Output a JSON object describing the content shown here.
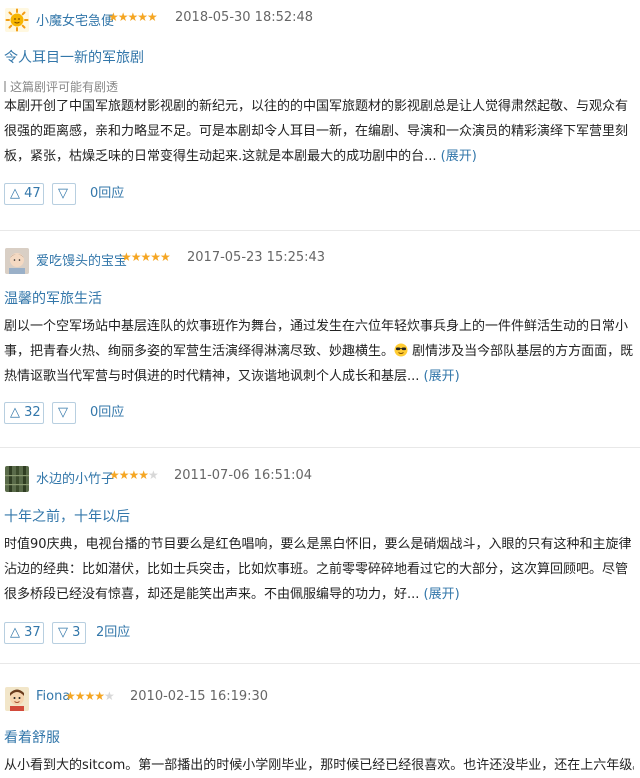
{
  "colors": {
    "link": "#3377aa",
    "star": "#f5a623",
    "meta": "#666666"
  },
  "reviews": [
    {
      "author": "小魔女宅急便",
      "rating": 5,
      "stars_on": "★★★★★",
      "stars_off": "",
      "time": "2018-05-30 18:52:48",
      "title": "令人耳目一新的军旅剧",
      "spoiler_note": "这篇剧评可能有剧透",
      "body": "本剧开创了中国军旅题材影视剧的新纪元，以往的的中国军旅题材的影视剧总是让人觉得肃然起敬、与观众有很强的距离感，亲和力略显不足。可是本剧却令人耳目一新，在编剧、导演和一众演员的精彩演绎下军营里刻板，紧张，枯燥乏味的日常变得生动起来.这就是本剧最大的成功剧中的台...",
      "expand": "(展开)",
      "up": "47",
      "reply": "0回应"
    },
    {
      "author": "爱吃馒头的宝宝",
      "rating": 5,
      "stars_on": "★★★★★",
      "stars_off": "",
      "time": "2017-05-23 15:25:43",
      "title": "温馨的军旅生活",
      "body_a": "剧以一个空军场站中基层连队的炊事班作为舞台，通过发生在六位年轻炊事兵身上的一件件鲜活生动的日常小事，把青春火热、绚丽多姿的军营生活演绎得淋漓尽致、妙趣横生。",
      "body_b": " 剧情涉及当今部队基层的方方面面，既热情讴歌当代军营与时俱进的时代精神，又诙谐地讽刺个人成长和基层...",
      "expand": "(展开)",
      "up": "32",
      "reply": "0回应"
    },
    {
      "author": "水边的小竹子",
      "rating": 4,
      "stars_on": "★★★★",
      "stars_off": "★",
      "time": "2011-07-06 16:51:04",
      "title": "十年之前，十年以后",
      "body": "时值90庆典，电视台播的节目要么是红色唱响，要么是黑白怀旧，要么是硝烟战斗，入眼的只有这种和主旋律沾边的经典：比如潜伏，比如士兵突击，比如炊事班。之前零零碎碎地看过它的大部分，这次算回顾吧。尽管很多桥段已经没有惊喜，却还是能笑出声来。不由佩服编导的功力，好...",
      "expand": "(展开)",
      "up": "37",
      "down": "3",
      "reply": "2回应"
    },
    {
      "author": "Fiona",
      "rating": 4,
      "stars_on": "★★★★",
      "stars_off": "★",
      "time": "2010-02-15 16:19:30",
      "title": "看着舒服",
      "body": "从小看到大的sitcom。第一部播出的时候小学刚毕业，那时候已经已经很喜欢。也许还没毕业，还在上六年级。晚上"
    }
  ]
}
